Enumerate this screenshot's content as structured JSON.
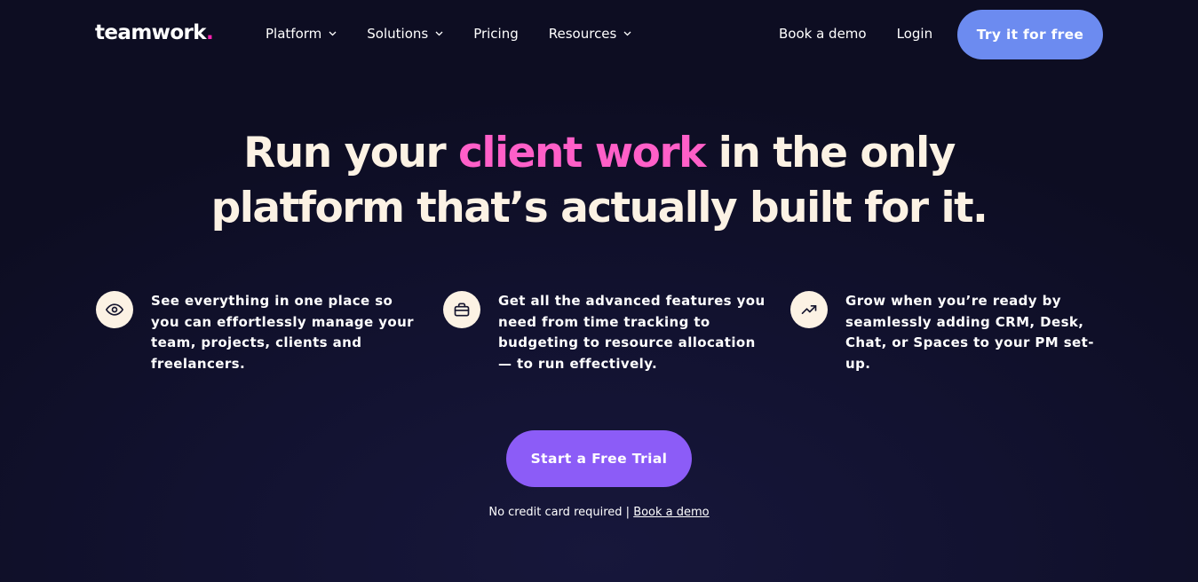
{
  "nav": {
    "logo": "teamwork",
    "logo_dot": ".",
    "links": [
      {
        "label": "Platform",
        "has_dropdown": true
      },
      {
        "label": "Solutions",
        "has_dropdown": true
      },
      {
        "label": "Pricing",
        "has_dropdown": false
      },
      {
        "label": "Resources",
        "has_dropdown": true
      }
    ],
    "book_demo": "Book a demo",
    "login": "Login",
    "try_free": "Try it for free"
  },
  "hero": {
    "headline_pre": "Run your ",
    "headline_accent": "client work",
    "headline_post_line1": " in the only",
    "headline_line2": "platform that’s actually built for it."
  },
  "features": [
    {
      "icon": "eye-icon",
      "text": "See everything in one place so you can effortlessly manage your team, projects, clients and freelancers."
    },
    {
      "icon": "briefcase-icon",
      "text": "Get all the advanced features you need from time tracking to budgeting to resource allocation — to run effectively."
    },
    {
      "icon": "trending-up-icon",
      "text": "Grow when you’re ready by seamlessly adding CRM, Desk, Chat, or Spaces to your PM set-up."
    }
  ],
  "cta": {
    "label": "Start a Free Trial",
    "note": "No credit card required | ",
    "note_link": "Book a demo"
  },
  "colors": {
    "background": "#0f0f26",
    "accent_pink": "#ff5fc8",
    "logo_dot": "#ff22b1",
    "try_button": "#6c8bf0",
    "cta_button": "#8c5cf7",
    "cream": "#fcf2e4"
  }
}
